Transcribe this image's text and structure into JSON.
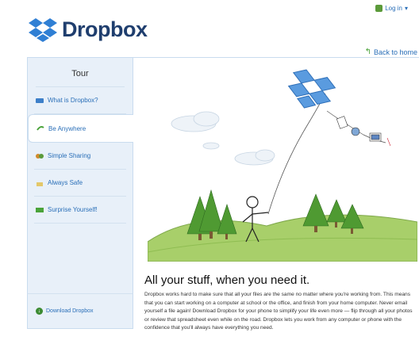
{
  "header": {
    "brand": "Dropbox",
    "login_label": "Log in",
    "back_home_label": "Back to home"
  },
  "sidebar": {
    "title": "Tour",
    "items": [
      {
        "label": "What is Dropbox?",
        "icon": "question-icon",
        "active": false
      },
      {
        "label": "Be Anywhere",
        "icon": "globe-arrow-icon",
        "active": true
      },
      {
        "label": "Simple Sharing",
        "icon": "share-icon",
        "active": false
      },
      {
        "label": "Always Safe",
        "icon": "lock-icon",
        "active": false
      },
      {
        "label": "Surprise Yourself!",
        "icon": "gift-icon",
        "active": false
      }
    ],
    "download_label": "Download Dropbox"
  },
  "content": {
    "headline": "All your stuff, when you need it.",
    "body": "Dropbox works hard to make sure that all your files are the same no matter where you're working from. This means that you can start working on a computer at school or the office, and finish from your home computer. Never email yourself a file again! Download Dropbox for your phone to simplify your life even more — flip through all your photos or review that spreadsheet even while on the road. Dropbox lets you work from any computer or phone with the confidence that you'll always have everything you need."
  },
  "colors": {
    "brand_navy": "#1f3e6e",
    "link_blue": "#2a6fb8",
    "sidebar_bg": "#e8f0f9",
    "border_blue": "#c9dcef"
  }
}
